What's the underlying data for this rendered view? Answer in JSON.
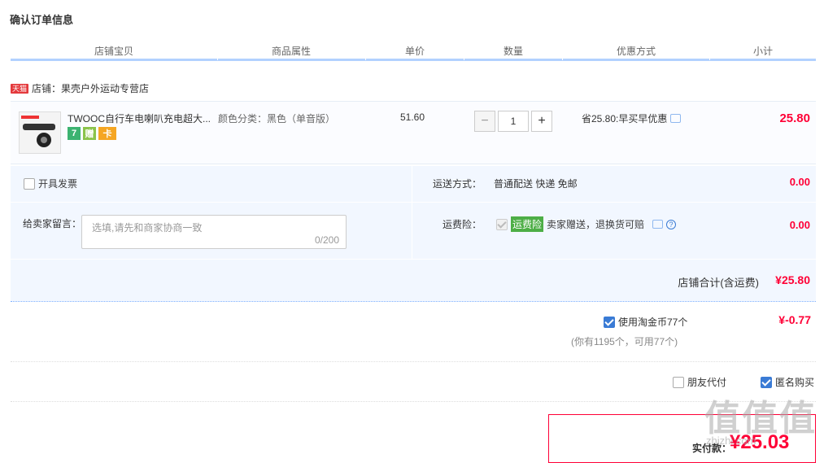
{
  "page": {
    "title": "确认订单信息"
  },
  "columns": [
    "店铺宝贝",
    "商品属性",
    "单价",
    "数量",
    "优惠方式",
    "小计"
  ],
  "store": {
    "badge": "天猫",
    "label": "店铺：果壳户外运动专营店"
  },
  "item": {
    "name": "TWOOC自行车电喇叭充电超大...",
    "badges": [
      "7",
      "赠",
      "卡"
    ],
    "attribute": "颜色分类：黑色（单音版）",
    "unit_price": "51.60",
    "qty_minus": "−",
    "qty_value": "1",
    "qty_plus": "+",
    "promo": "省25.80:早买早优惠",
    "subtotal": "25.80"
  },
  "options": {
    "invoice_label": "开具发票",
    "shipping_label": "运送方式：",
    "shipping_value": "普通配送 快递 免邮",
    "shipping_fee": "0.00",
    "message_label": "给卖家留言：",
    "message_placeholder": "选填,请先和商家协商一致",
    "message_count": "0/200",
    "insurance_label": "运费险：",
    "insurance_tag": "运费险",
    "insurance_text": "卖家赠送，退换货可赔",
    "insurance_fee": "0.00",
    "store_total_label": "店铺合计(含运费)",
    "store_total": "¥25.80"
  },
  "coins": {
    "label": "使用淘金币77个",
    "note": "(你有1195个，可用77个)",
    "discount": "¥-0.77"
  },
  "extras": {
    "friend_pay": "朋友代付",
    "anonymous": "匿名购买"
  },
  "payment": {
    "label": "实付款：",
    "amount": "¥25.03"
  },
  "watermark": "值值值",
  "watermark_sub": "zhizhi.com"
}
